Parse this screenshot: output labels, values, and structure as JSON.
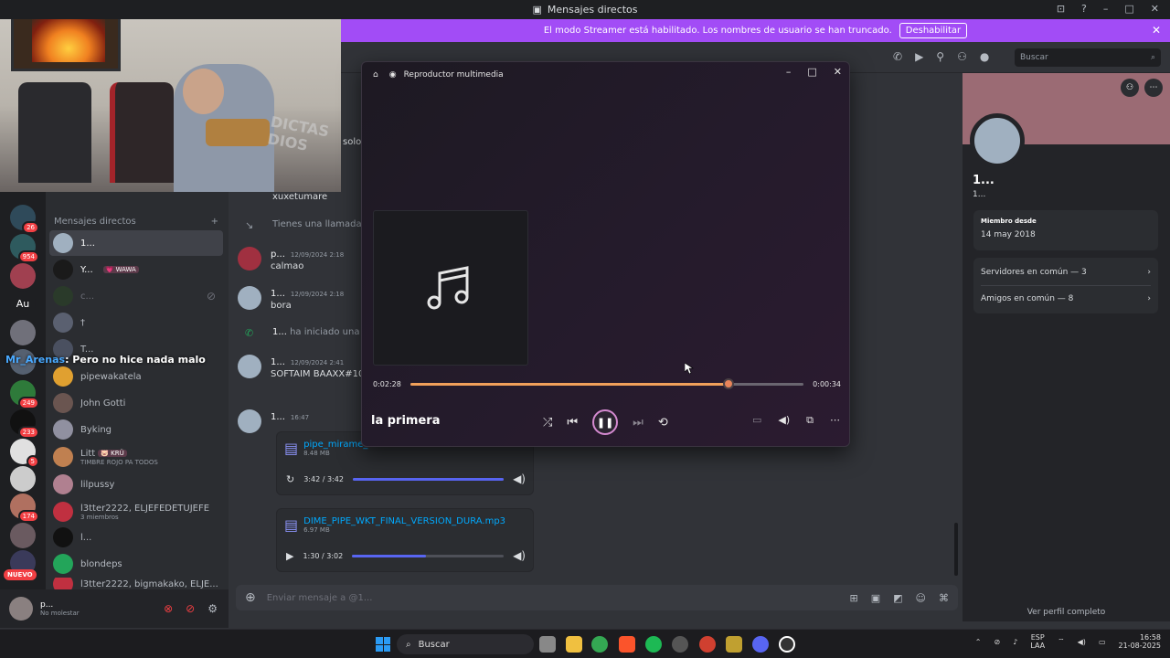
{
  "window": {
    "title": "Mensajes directos"
  },
  "streamer_banner": {
    "text": "El modo Streamer está habilitado. Los nombres de usuario se han truncado.",
    "button": "Deshabilitar"
  },
  "topbar": {
    "search_placeholder": "Buscar"
  },
  "guild_badges": [
    "26",
    "954",
    "249",
    "233",
    "5",
    "174"
  ],
  "guild_labels": {
    "au": "Au",
    "nuevo": "NUEVO"
  },
  "dm_section": {
    "header": "Mensajes directos",
    "add": "+"
  },
  "dms": [
    {
      "name": "1..."
    },
    {
      "name": "Y...",
      "tag": "💗 WAWA"
    },
    {
      "name": "c..."
    },
    {
      "name": "†"
    },
    {
      "name": "T..."
    },
    {
      "name": "pipewakatela"
    },
    {
      "name": "John Gotti"
    },
    {
      "name": "Byking"
    },
    {
      "name": "Litt",
      "tag": "🐷 KRÜ",
      "sub": "TIMBRE ROJO PA TODOS"
    },
    {
      "name": "lilpussy"
    },
    {
      "name": "l3tter2222, ELJEFEDETUJEFE",
      "sub": "3 miembros"
    },
    {
      "name": "l..."
    },
    {
      "name": "blondeps"
    },
    {
      "name": "l3tter2222, bigmakako, ELJE..."
    }
  ],
  "user_panel": {
    "name": "p...",
    "status": "No molestar"
  },
  "overlay": {
    "user": "Mr_Arenas",
    "message": ": Pero no hice nada malo"
  },
  "webcam_overlay_text": "DICTAS DIOS",
  "chat": {
    "partial_top": "solo",
    "first_user": "xuxetumare",
    "missed_call": "Tienes una llamada pe",
    "messages": [
      {
        "name": "p...",
        "time": "12/09/2024 2:18",
        "text": "calmao"
      },
      {
        "name": "1...",
        "time": "12/09/2024 2:18",
        "text": "bora"
      },
      {
        "name": "1...",
        "time": "12/09/2024 2:41",
        "text": "SOFTAIM BAAXX#102"
      },
      {
        "name": "1...",
        "time": "16:47",
        "text": ""
      }
    ],
    "call_started": {
      "name": "1...",
      "text": "ha iniciado una llam"
    },
    "attachments": [
      {
        "filename": "pipe_mirame_",
        "size": "8.48 MB",
        "time": "3:42 / 3:42",
        "progress": 1.0
      },
      {
        "filename": "DIME_PIPE_WKT_FINAL_VERSION_DURA.mp3",
        "size": "6.97 MB",
        "time": "1:30 / 3:02",
        "progress": 0.49
      }
    ],
    "composer_placeholder": "Enviar mensaje a @1..."
  },
  "profile": {
    "name": "1...",
    "sub": "1...",
    "member_since_label": "Miembro desde",
    "member_since": "14 may 2018",
    "servers": "Servidores en común — 3",
    "friends": "Amigos en común — 8",
    "full_profile": "Ver perfil completo"
  },
  "player": {
    "title": "Reproductor multimedia",
    "elapsed": "0:02:28",
    "remaining": "0:00:34",
    "progress": 0.81,
    "track": "la primera"
  },
  "taskbar": {
    "search": "Buscar",
    "lang1": "ESP",
    "lang2": "LAA",
    "time": "16:58",
    "date": "21-08-2025"
  }
}
